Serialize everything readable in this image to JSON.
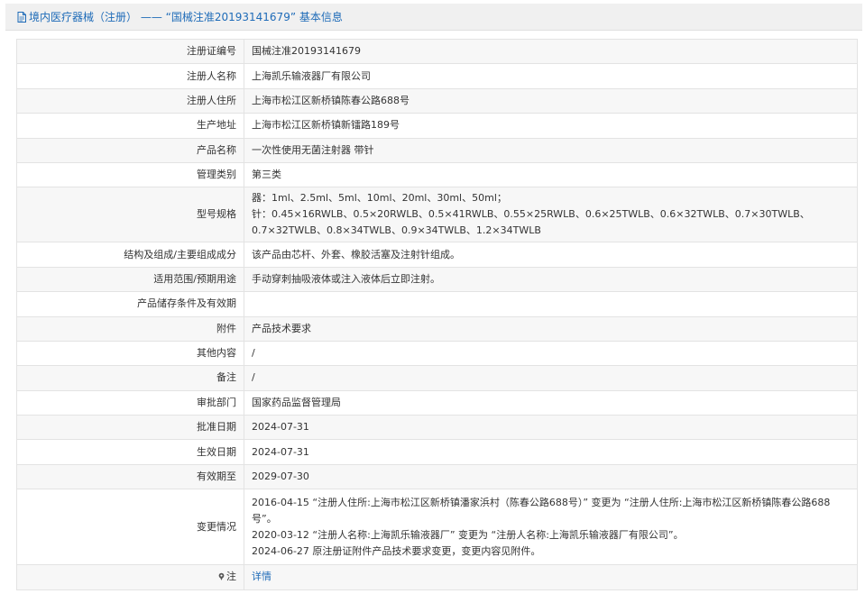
{
  "header": {
    "title": "境内医疗器械（注册） —— “国械注准20193141679” 基本信息"
  },
  "rows": [
    {
      "label": "注册证编号",
      "value": "国械注准20193141679"
    },
    {
      "label": "注册人名称",
      "value": "上海凯乐输液器厂有限公司"
    },
    {
      "label": "注册人住所",
      "value": "上海市松江区新桥镇陈春公路688号"
    },
    {
      "label": "生产地址",
      "value": "上海市松江区新桥镇新镭路189号"
    },
    {
      "label": "产品名称",
      "value": "一次性使用无菌注射器 带针"
    },
    {
      "label": "管理类别",
      "value": "第三类"
    },
    {
      "label": "型号规格",
      "lines": [
        "器：1ml、2.5ml、5ml、10ml、20ml、30ml、50ml；",
        "针：0.45×16RWLB、0.5×20RWLB、0.5×41RWLB、0.55×25RWLB、0.6×25TWLB、0.6×32TWLB、0.7×30TWLB、0.7×32TWLB、0.8×34TWLB、0.9×34TWLB、1.2×34TWLB"
      ]
    },
    {
      "label": "结构及组成/主要组成成分",
      "value": "该产品由芯杆、外套、橡胶活塞及注射针组成。"
    },
    {
      "label": "适用范围/预期用途",
      "value": "手动穿刺抽吸液体或注入液体后立即注射。"
    },
    {
      "label": "产品储存条件及有效期",
      "value": ""
    },
    {
      "label": "附件",
      "value": "产品技术要求"
    },
    {
      "label": "其他内容",
      "value": "/"
    },
    {
      "label": "备注",
      "value": "/"
    },
    {
      "label": "审批部门",
      "value": "国家药品监督管理局"
    },
    {
      "label": "批准日期",
      "value": "2024-07-31"
    },
    {
      "label": "生效日期",
      "value": "2024-07-31"
    },
    {
      "label": "有效期至",
      "value": "2029-07-30"
    },
    {
      "label": "变更情况",
      "lines": [
        "2016-04-15 “注册人住所:上海市松江区新桥镇潘家浜村（陈春公路688号）” 变更为 “注册人住所:上海市松江区新桥镇陈春公路688号”。",
        "2020-03-12 “注册人名称:上海凯乐输液器厂” 变更为 “注册人名称:上海凯乐输液器厂有限公司”。",
        "2024-06-27 原注册证附件产品技术要求变更，变更内容见附件。"
      ]
    },
    {
      "label": "注",
      "value": "详情"
    }
  ],
  "icons": {
    "header": "document-icon",
    "note": "pin-icon"
  },
  "colors": {
    "accent": "#1e6bb8",
    "row_alt": "#f7f7f7",
    "border": "#e3e3e3"
  }
}
